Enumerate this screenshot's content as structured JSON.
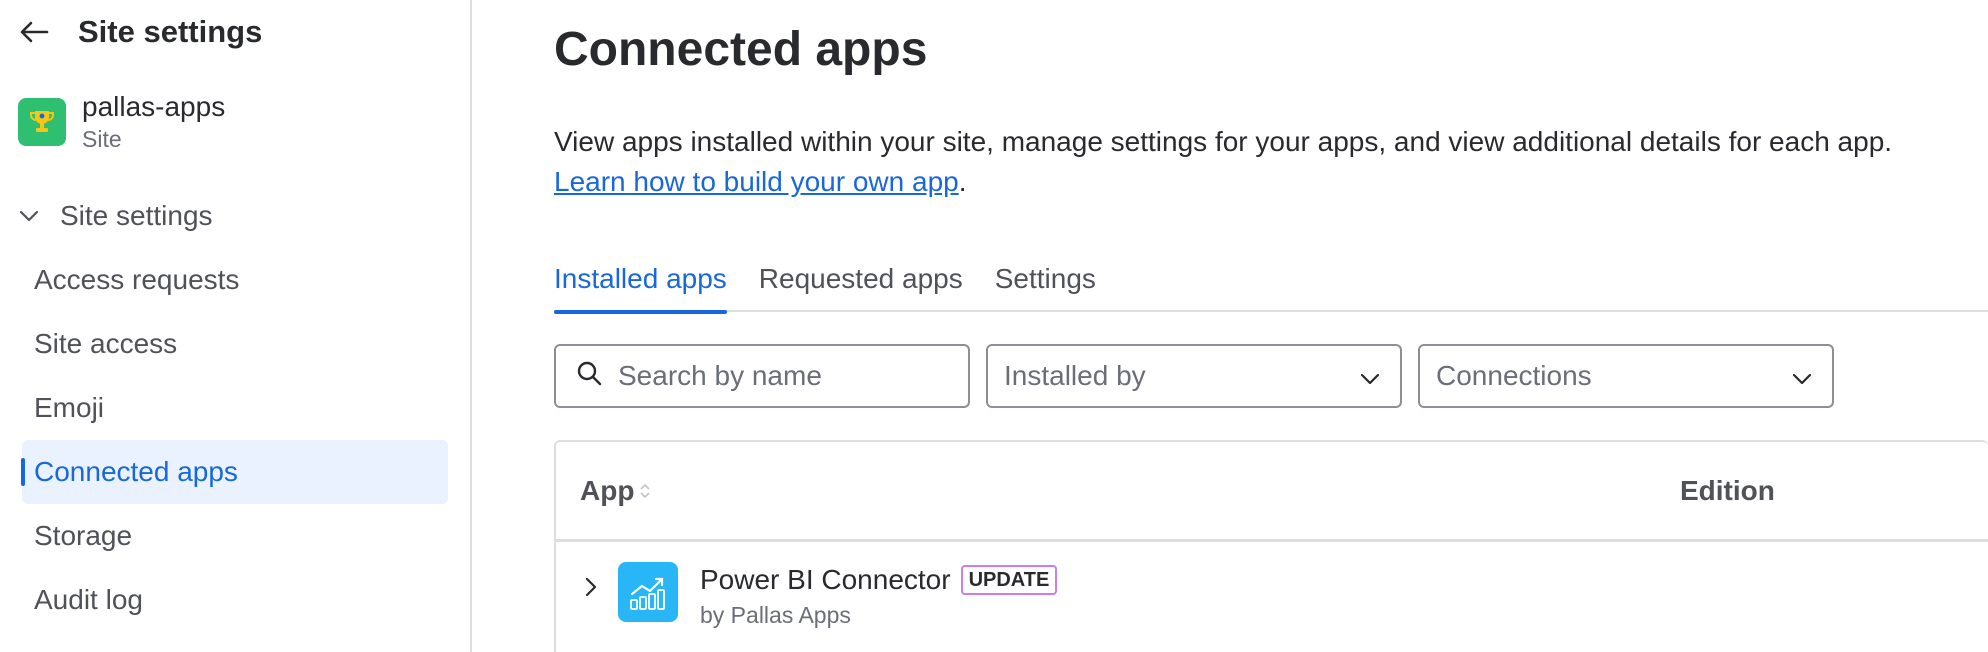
{
  "sidebar": {
    "title": "Site settings",
    "site": {
      "name": "pallas-apps",
      "type": "Site"
    },
    "group_label": "Site settings",
    "items": [
      {
        "label": "Access requests",
        "active": false
      },
      {
        "label": "Site access",
        "active": false
      },
      {
        "label": "Emoji",
        "active": false
      },
      {
        "label": "Connected apps",
        "active": true
      },
      {
        "label": "Storage",
        "active": false
      },
      {
        "label": "Audit log",
        "active": false
      }
    ]
  },
  "main": {
    "title": "Connected apps",
    "description": "View apps installed within your site, manage settings for your apps, and view additional details for each app.",
    "learn_link": "Learn how to build your own app",
    "learn_suffix": ".",
    "tabs": [
      {
        "label": "Installed apps",
        "active": true
      },
      {
        "label": "Requested apps",
        "active": false
      },
      {
        "label": "Settings",
        "active": false
      }
    ],
    "filters": {
      "search_placeholder": "Search by name",
      "installed_by": "Installed by",
      "connections": "Connections"
    },
    "table": {
      "columns": {
        "app": "App",
        "edition": "Edition"
      },
      "rows": [
        {
          "name": "Power BI Connector",
          "badge": "UPDATE",
          "vendor": "by Pallas Apps"
        }
      ]
    }
  },
  "colors": {
    "accent": "#1868db",
    "active_bg": "#e9f2fe",
    "site_avatar": "#2fbf71",
    "app_icon": "#29b6f6",
    "badge_border": "#c97cf4"
  },
  "icons": {
    "back": "arrow-left-icon",
    "site": "trophy-icon",
    "group": "chevron-down-icon",
    "search": "search-icon",
    "select": "chevron-down-icon",
    "sort": "sort-icon",
    "row_expand": "chevron-right-icon",
    "app": "chart-icon"
  }
}
